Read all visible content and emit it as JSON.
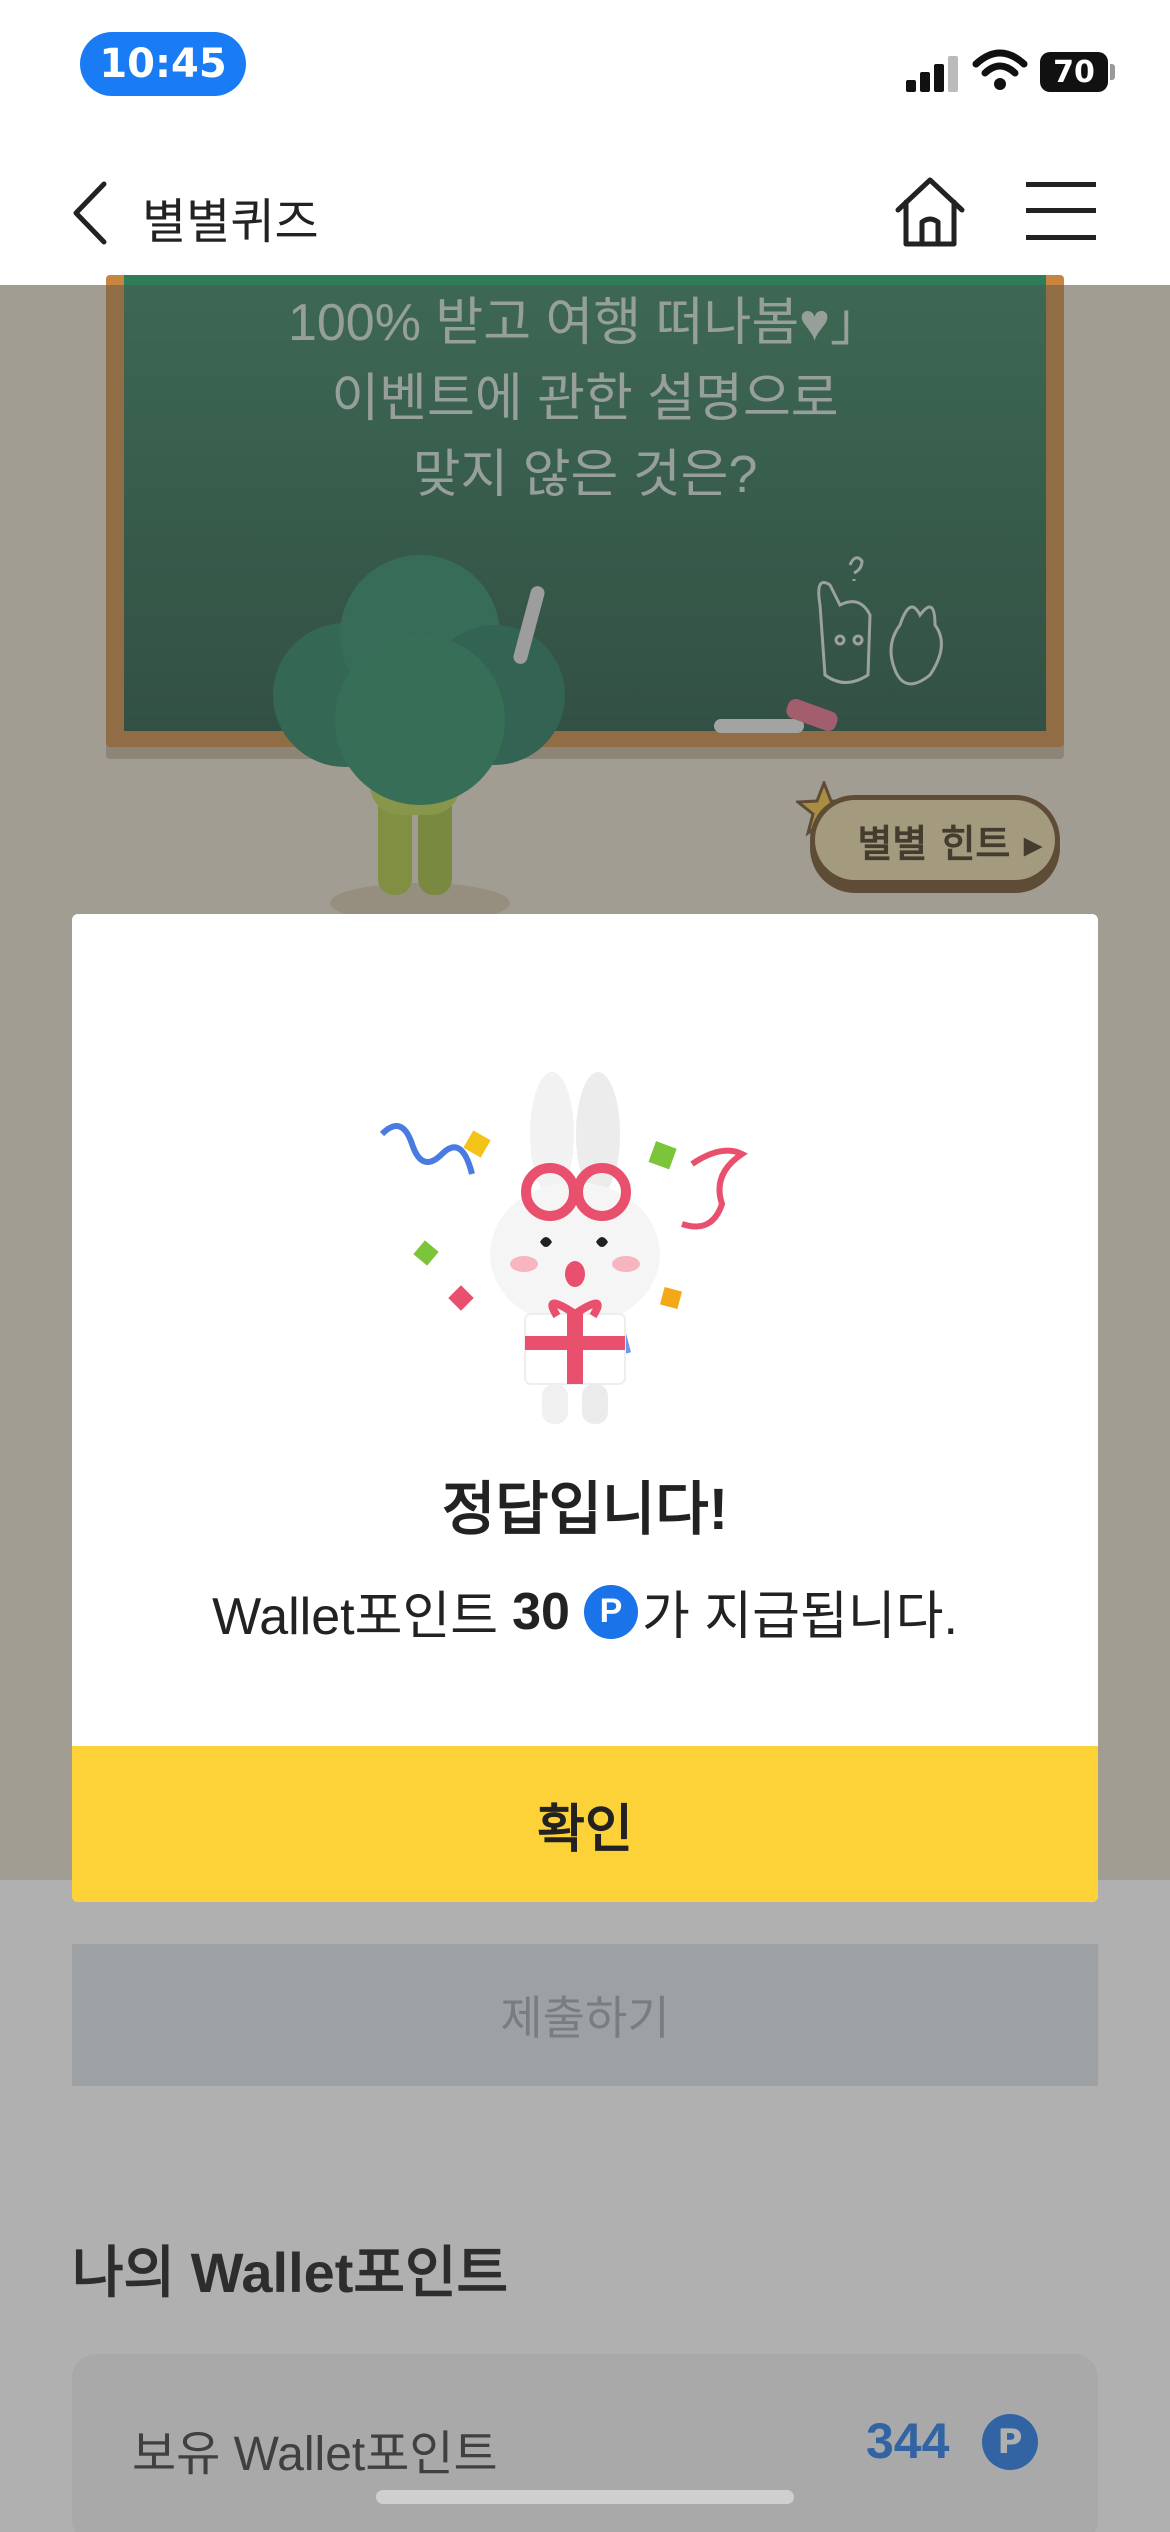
{
  "status_bar": {
    "time": "10:45",
    "battery": "70"
  },
  "nav": {
    "title": "별별퀴즈"
  },
  "quiz": {
    "question_lines": [
      "100% 받고 여행 떠나봄♥」",
      "이벤트에 관한 설명으로",
      "맞지 않은 것은?"
    ],
    "hint_label": "별별 힌트 ▸"
  },
  "modal": {
    "title": "정답입니다!",
    "message_prefix": "Wallet포인트",
    "points": "30",
    "point_symbol": "P",
    "message_suffix": "가 지급됩니다.",
    "confirm_label": "확인"
  },
  "submit_label": "제출하기",
  "wallet": {
    "section_title": "나의 Wallet포인트",
    "label": "보유 Wallet포인트",
    "value": "344",
    "symbol": "P"
  },
  "colors": {
    "accent": "#fdd138",
    "point_blue": "#1a73e8",
    "time_pill": "#1a7cf5"
  }
}
